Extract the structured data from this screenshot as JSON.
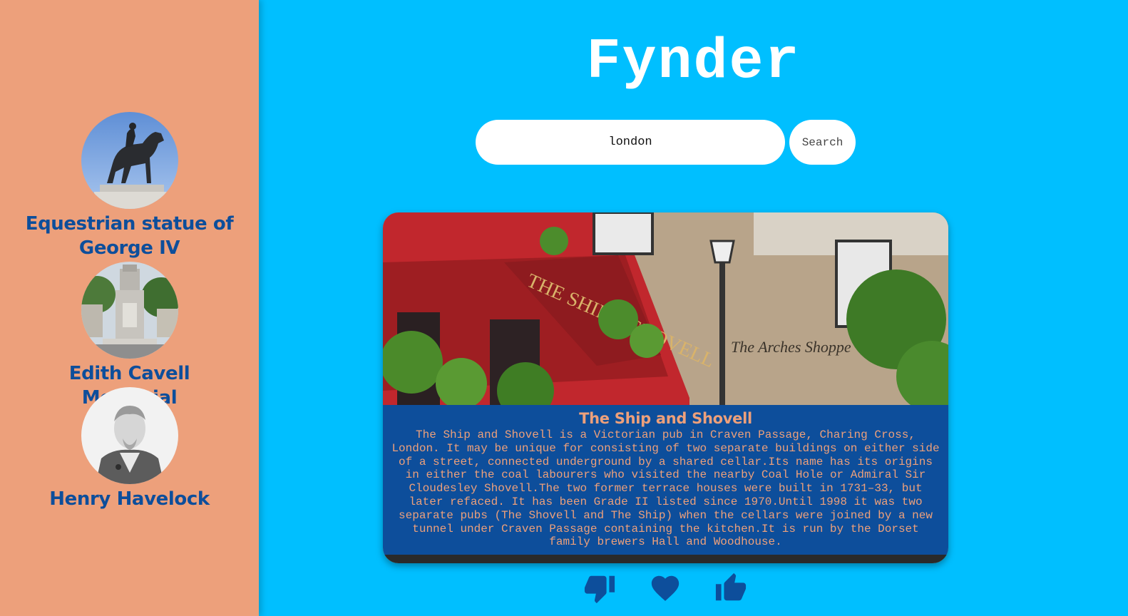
{
  "app": {
    "title": "Fynder"
  },
  "search": {
    "value": "london",
    "button_label": "Search"
  },
  "sidebar": {
    "items": [
      {
        "name": "Equestrian statue of George IV",
        "image": "equestrian-statue-photo"
      },
      {
        "name": "Edith Cavell Memorial",
        "image": "memorial-photo"
      },
      {
        "name": "Henry Havelock",
        "image": "portrait-engraving"
      }
    ]
  },
  "card": {
    "title": "The Ship and Shovell",
    "description": "The Ship and Shovell is a Victorian pub in Craven Passage, Charing Cross, London. It may be unique for consisting of two separate buildings on either side of a street, connected underground by a shared cellar.Its name has its origins in either the coal labourers who visited the nearby Coal Hole or Admiral Sir Cloudesley Shovell.The two former terrace houses were built in 1731–33, but later refaced. It has been Grade II listed since 1970.Until 1998 it was two separate pubs (The Shovell and The Ship) when the cellars were joined by a new tunnel under Craven Passage containing the kitchen.It is run by the Dorset family brewers Hall and Woodhouse.",
    "photo_sign_text": "THE SHIP & SHOVELL",
    "photo_wall_text": "The Arches Shoppe"
  },
  "actions": {
    "dislike": "thumbs-down-icon",
    "favorite": "heart-icon",
    "like": "thumbs-up-icon"
  },
  "colors": {
    "background": "#00bfff",
    "sidebar": "#eda07b",
    "accent": "#0d4e9b",
    "white": "#ffffff"
  }
}
